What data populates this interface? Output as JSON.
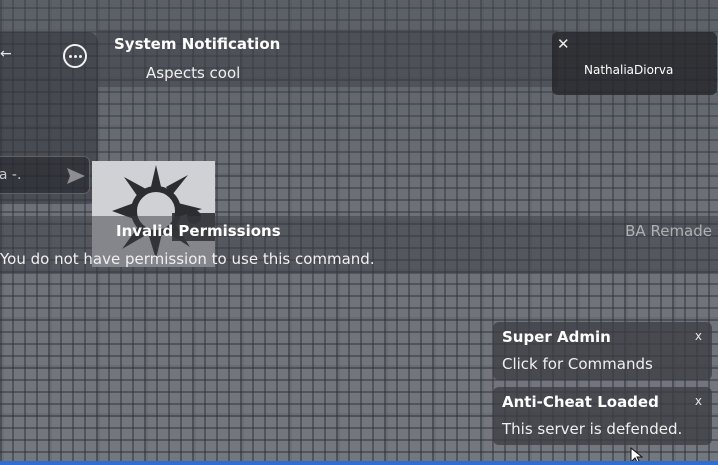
{
  "colors": {
    "panel_bg": "#3a3c42",
    "text_primary": "#ffffff",
    "text_muted": "#aeb0b3",
    "accent_strip": "#2e6fd0",
    "decal_bg": "#cfd1d4",
    "decal_star": "#2b2d31"
  },
  "chat": {
    "edge_glyph": "←",
    "more_icon": "ellipsis-circle-icon",
    "input_text": "la -.",
    "send_icon": "paper-plane-icon"
  },
  "system_notification": {
    "title": "System Notification",
    "message": "Aspects cool"
  },
  "player_card": {
    "close_label": "✕",
    "name": "NathaliaDiorva"
  },
  "permission_notice": {
    "title": "Invalid Permissions",
    "source": "BA Remade",
    "message": "You do not have permission to use this command."
  },
  "toasts": [
    {
      "title": "Super Admin",
      "body": "Click for Commands",
      "close_label": "x"
    },
    {
      "title": "Anti-Cheat Loaded",
      "body": "This server is defended.",
      "close_label": "x"
    }
  ]
}
